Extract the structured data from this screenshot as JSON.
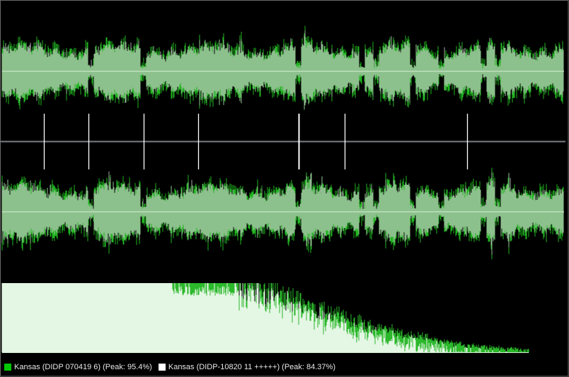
{
  "colors": {
    "background": "#000000",
    "waveform_fill": "#8cc08c",
    "waveform_green_edge": "#21b521",
    "waveform_grey_edge": "#a8a8a8",
    "center_line": "#c8e8c8",
    "divider_line": "#7a8088",
    "marker_line": "#ffffff",
    "spectrum_white": "#e4f6e4",
    "spectrum_green": "#2bb82b"
  },
  "legend": [
    {
      "label": "Kansas (DIDP 070419 6) (Peak: 95.4%)",
      "color": "#00c800",
      "icon": "green-square-icon"
    },
    {
      "label": "Kansas (DIDP-10820 11 +++++) (Peak: 84.37%)",
      "color": "#ffffff",
      "icon": "white-square-icon"
    }
  ],
  "chart_data": {
    "type": "area",
    "channels": [
      "top-waveform",
      "bottom-waveform",
      "spectrum"
    ],
    "series": [
      {
        "name": "Kansas (DIDP 070419 6)",
        "peak_percent": 95.4
      },
      {
        "name": "Kansas (DIDP-10820 11 +++++)",
        "peak_percent": 84.37
      }
    ],
    "track_marker_fractions": [
      0.077,
      0.156,
      0.253,
      0.35,
      0.527,
      0.609,
      0.826
    ],
    "waveform_quiet_fractions": [
      0.16,
      0.253,
      0.527,
      0.64,
      0.665,
      0.73,
      0.78,
      0.855,
      0.88
    ],
    "spectrum_rolloff_fraction": 0.42,
    "spectrum_end_fraction": 0.935
  }
}
